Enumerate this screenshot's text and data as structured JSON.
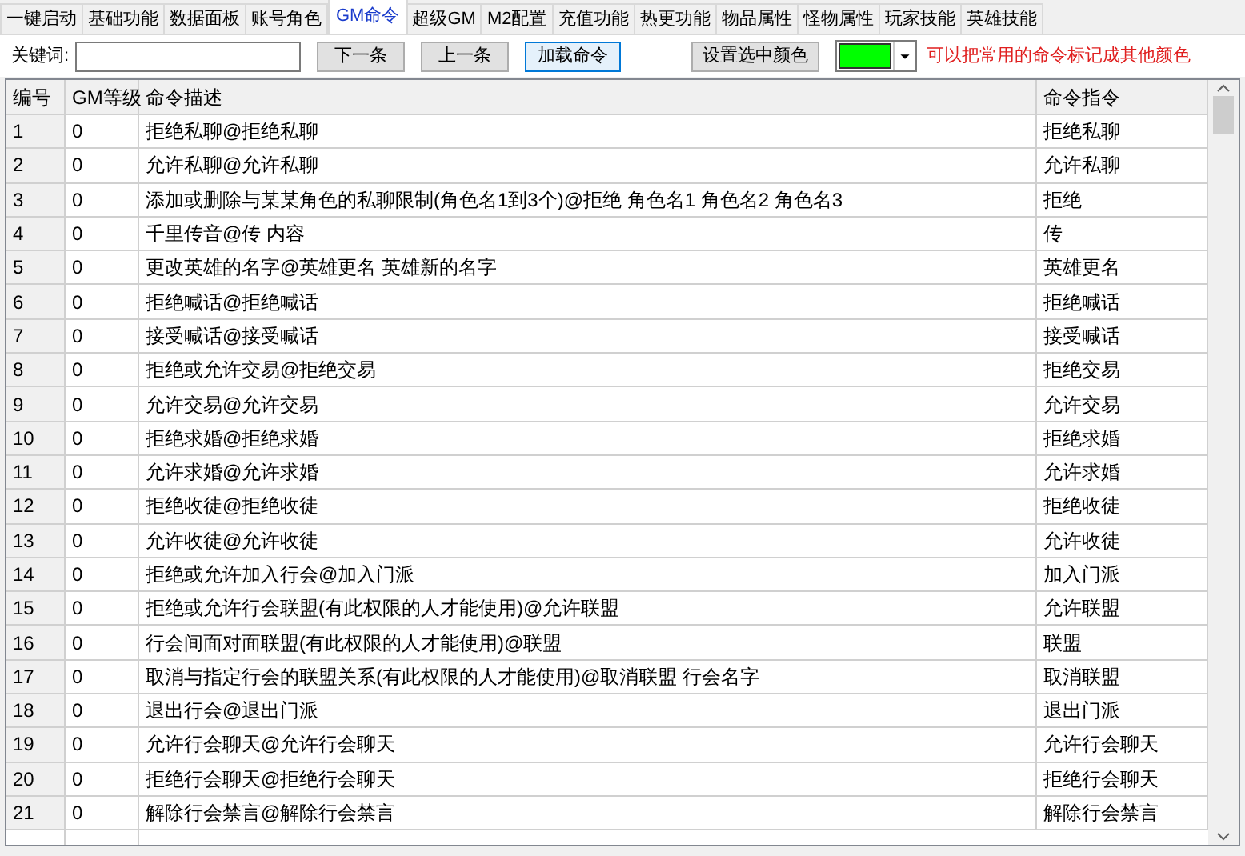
{
  "tabs": [
    {
      "label": "一键启动",
      "selected": false
    },
    {
      "label": "基础功能",
      "selected": false
    },
    {
      "label": "数据面板",
      "selected": false
    },
    {
      "label": "账号角色",
      "selected": false
    },
    {
      "label": "GM命令",
      "selected": true
    },
    {
      "label": "超级GM",
      "selected": false
    },
    {
      "label": "M2配置",
      "selected": false
    },
    {
      "label": "充值功能",
      "selected": false
    },
    {
      "label": "热更功能",
      "selected": false
    },
    {
      "label": "物品属性",
      "selected": false
    },
    {
      "label": "怪物属性",
      "selected": false
    },
    {
      "label": "玩家技能",
      "selected": false
    },
    {
      "label": "英雄技能",
      "selected": false
    }
  ],
  "toolbar": {
    "keyword_label": "关键词:",
    "buttons": [
      "下一条",
      "上一条",
      "加载命令"
    ],
    "set_color_button": "设置选中颜色",
    "color_picker": {
      "color": "#00ff00"
    },
    "hint": "可以把常用的命令标记成其他颜色"
  },
  "table": {
    "columns": [
      "编号",
      "GM等级",
      "命令描述",
      "命令指令"
    ],
    "rows": [
      [
        "1",
        "0",
        "拒绝私聊@拒绝私聊",
        "拒绝私聊"
      ],
      [
        "2",
        "0",
        "允许私聊@允许私聊",
        "允许私聊"
      ],
      [
        "3",
        "0",
        "添加或删除与某某角色的私聊限制(角色名1到3个)@拒绝 角色名1 角色名2 角色名3",
        "拒绝"
      ],
      [
        "4",
        "0",
        "千里传音@传 内容",
        "传"
      ],
      [
        "5",
        "0",
        "更改英雄的名字@英雄更名 英雄新的名字",
        "英雄更名"
      ],
      [
        "6",
        "0",
        "拒绝喊话@拒绝喊话",
        "拒绝喊话"
      ],
      [
        "7",
        "0",
        "接受喊话@接受喊话",
        "接受喊话"
      ],
      [
        "8",
        "0",
        "拒绝或允许交易@拒绝交易",
        "拒绝交易"
      ],
      [
        "9",
        "0",
        "允许交易@允许交易",
        "允许交易"
      ],
      [
        "10",
        "0",
        "拒绝求婚@拒绝求婚",
        "拒绝求婚"
      ],
      [
        "11",
        "0",
        "允许求婚@允许求婚",
        "允许求婚"
      ],
      [
        "12",
        "0",
        "拒绝收徒@拒绝收徒",
        "拒绝收徒"
      ],
      [
        "13",
        "0",
        "允许收徒@允许收徒",
        "允许收徒"
      ],
      [
        "14",
        "0",
        "拒绝或允许加入行会@加入门派",
        "加入门派"
      ],
      [
        "15",
        "0",
        "拒绝或允许行会联盟(有此权限的人才能使用)@允许联盟",
        "允许联盟"
      ],
      [
        "16",
        "0",
        "行会间面对面联盟(有此权限的人才能使用)@联盟",
        "联盟"
      ],
      [
        "17",
        "0",
        "取消与指定行会的联盟关系(有此权限的人才能使用)@取消联盟 行会名字",
        "取消联盟"
      ],
      [
        "18",
        "0",
        "退出行会@退出门派",
        "退出门派"
      ],
      [
        "19",
        "0",
        "允许行会聊天@允许行会聊天",
        "允许行会聊天"
      ],
      [
        "20",
        "0",
        "拒绝行会聊天@拒绝行会聊天",
        "拒绝行会聊天"
      ],
      [
        "21",
        "0",
        "解除行会禁言@解除行会禁言",
        "解除行会禁言"
      ]
    ]
  }
}
